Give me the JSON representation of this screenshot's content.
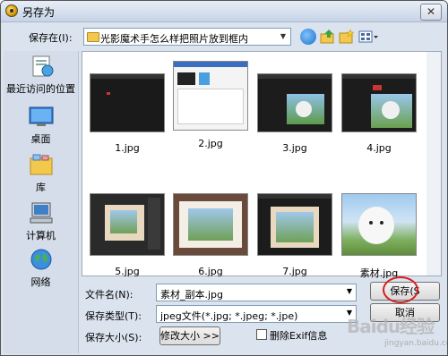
{
  "window": {
    "title": "另存为",
    "close_glyph": "✕"
  },
  "toolbar": {
    "save_in_label": "保存在(I):",
    "current_folder": "光影魔术手怎么样把照片放到框内",
    "icons": [
      "back-icon",
      "up-folder-icon",
      "new-folder-icon",
      "view-menu-icon"
    ]
  },
  "places": [
    {
      "label": "最近访问的位置",
      "icon": "recent-places-icon"
    },
    {
      "label": "桌面",
      "icon": "desktop-icon"
    },
    {
      "label": "库",
      "icon": "libraries-icon"
    },
    {
      "label": "计算机",
      "icon": "computer-icon"
    },
    {
      "label": "网络",
      "icon": "network-icon"
    }
  ],
  "files": [
    {
      "name": "1.jpg"
    },
    {
      "name": "2.jpg"
    },
    {
      "name": "3.jpg"
    },
    {
      "name": "4.jpg"
    },
    {
      "name": "5.jpg"
    },
    {
      "name": "6.jpg"
    },
    {
      "name": "7.jpg"
    },
    {
      "name": "素材.jpg"
    }
  ],
  "form": {
    "filename_label": "文件名(N):",
    "filename_value": "素材_副本.jpg",
    "filetype_label": "保存类型(T):",
    "filetype_value": "jpeg文件(*.jpg; *.jpeg; *.jpe)",
    "size_label": "保存大小(S):",
    "resize_button": "修改大小 >>",
    "remove_exif_label": "删除Exif信息",
    "save_button": "保存(S",
    "cancel_button": "取消"
  },
  "colors": {
    "highlight_circle": "#d42020"
  },
  "watermark": {
    "brand": "Baidu经验",
    "url": "jingyan.baidu.com"
  }
}
